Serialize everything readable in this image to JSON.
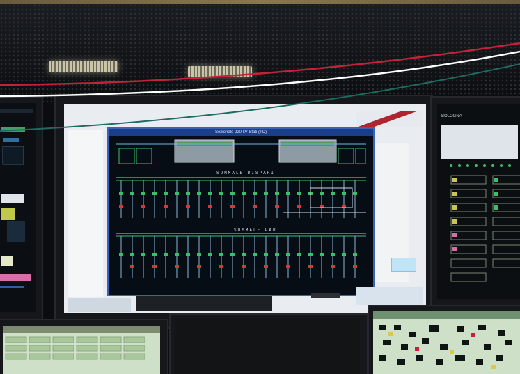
{
  "photo": {
    "description_tags": [
      "control-room",
      "scada-display"
    ],
    "colors": {
      "swoosh_red": "#c4223a",
      "swoosh_white": "#ffffff",
      "swoosh_teal": "#1e6b62",
      "panel_blue": "#3a63b8",
      "busbar_red": "#d23a3a",
      "busbar_green": "#39c06a"
    }
  },
  "main_display": {
    "title": "Sezionale 220 kV Stati (TC)",
    "bus_top": "SOMMALE DISPARI",
    "bus_bottom": "SOMMALE PARI"
  },
  "right_display": {
    "header": "BOLOGNA"
  }
}
